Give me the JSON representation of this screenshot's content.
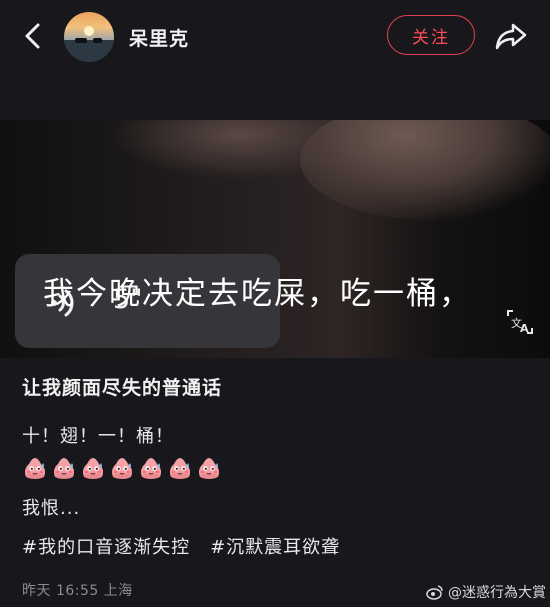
{
  "header": {
    "username": "呆里克",
    "follow_label": "关注",
    "icons": [
      "chevron-left-icon",
      "avatar",
      "share-icon"
    ]
  },
  "media": {
    "voice_duration": "5\"",
    "caption": "我今晚决定去吃屎，吃一桶，",
    "icons": [
      "voice-wave-icon",
      "translate-icon"
    ]
  },
  "post": {
    "title": "让我颜面尽失的普通话",
    "line1": "十！翅！一！桶！",
    "emoji_count": 7,
    "line3": "我恨...",
    "tags": [
      "#我的口音逐渐失控",
      "#沉默震耳欲聋"
    ],
    "meta": "昨天 16:55 上海"
  },
  "watermark": {
    "text": "@迷惑行為大賞",
    "icon": "weibo-icon"
  },
  "colors": {
    "background": "#17171c",
    "accent": "#ff4d5a",
    "voice_bubble": "#35353a"
  }
}
